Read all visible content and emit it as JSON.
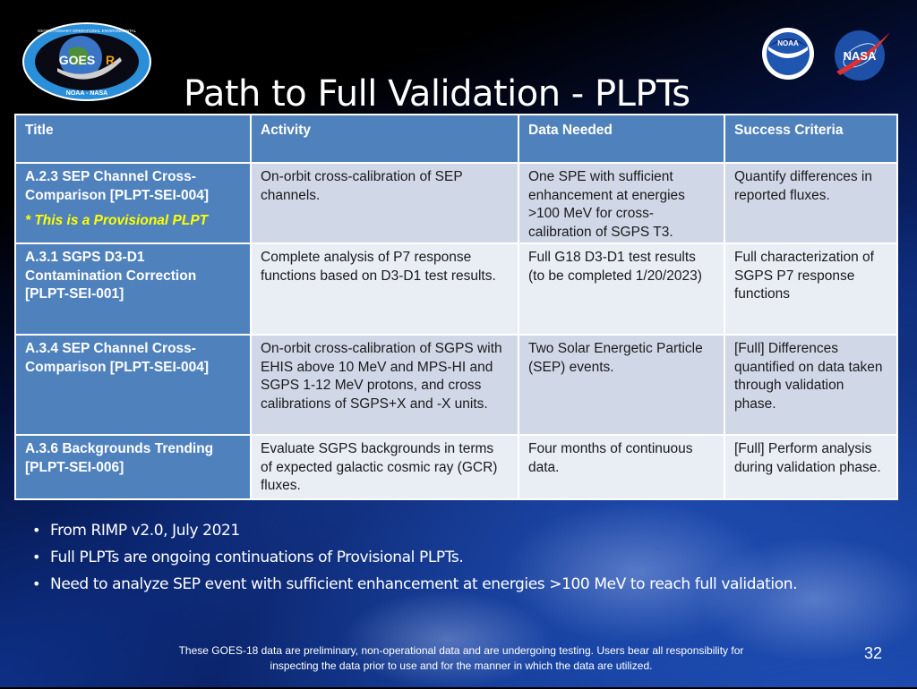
{
  "slide": {
    "title": "Path to Full Validation - PLPTs",
    "page_number": "32"
  },
  "logos": {
    "goes": {
      "ring_text": "GEOSTATIONARY OPERATIONAL ENVIRONMENTAL SATELLITE-R SERIES",
      "center_text": "GOES",
      "center_suffix": "R",
      "bottom_text": "NOAA - NASA"
    },
    "noaa": {
      "text": "NOAA"
    },
    "nasa": {
      "text": "NASA"
    }
  },
  "table": {
    "headers": [
      "Title",
      "Activity",
      "Data Needed",
      "Success Criteria"
    ],
    "rows": [
      {
        "title": "A.2.3 SEP Channel Cross-Comparison [PLPT-SEI-004]",
        "note": "* This is a Provisional PLPT",
        "activity": "On-orbit cross-calibration of SEP channels.",
        "data_needed": "One SPE with sufficient enhancement at energies >100 MeV for cross-calibration of SGPS T3.",
        "success_criteria": "Quantify differences in reported fluxes."
      },
      {
        "title": "A.3.1 SGPS D3-D1 Contamination Correction [PLPT-SEI-001]",
        "activity": "Complete analysis of P7 response functions based on D3-D1 test results.",
        "data_needed": "Full G18 D3-D1 test results (to be completed 1/20/2023)",
        "success_criteria": "Full characterization of SGPS P7 response functions"
      },
      {
        "title": "A.3.4 SEP Channel Cross-Comparison [PLPT-SEI-004]",
        "activity": "On-orbit cross-calibration of SGPS with EHIS above 10 MeV and MPS-HI and SGPS 1-12 MeV protons, and cross calibrations of SGPS+X and -X units.",
        "data_needed": "Two Solar Energetic Particle (SEP) events.",
        "success_criteria": "[Full] Differences quantified on data taken through validation phase."
      },
      {
        "title": "A.3.6 Backgrounds Trending [PLPT-SEI-006]",
        "activity": "Evaluate SGPS backgrounds in terms of expected galactic cosmic ray (GCR) fluxes.",
        "data_needed": "Four months of continuous data.",
        "success_criteria": "[Full] Perform analysis during validation phase."
      }
    ]
  },
  "bullets": [
    "From RIMP v2.0, July 2021",
    "Full PLPTs are ongoing continuations of Provisional PLPTs.",
    "Need to analyze SEP event with sufficient enhancement at energies >100 MeV to reach full validation."
  ],
  "disclaimer": "These GOES-18 data are preliminary, non-operational data and are undergoing testing. Users bear all responsibility for inspecting the data prior to use and for the manner in which the data are utilized.",
  "colors": {
    "header_blue": "#4f81bd",
    "row_light": "#d0d8e8",
    "row_lighter": "#e9edf4",
    "note_yellow": "#ffff00"
  }
}
